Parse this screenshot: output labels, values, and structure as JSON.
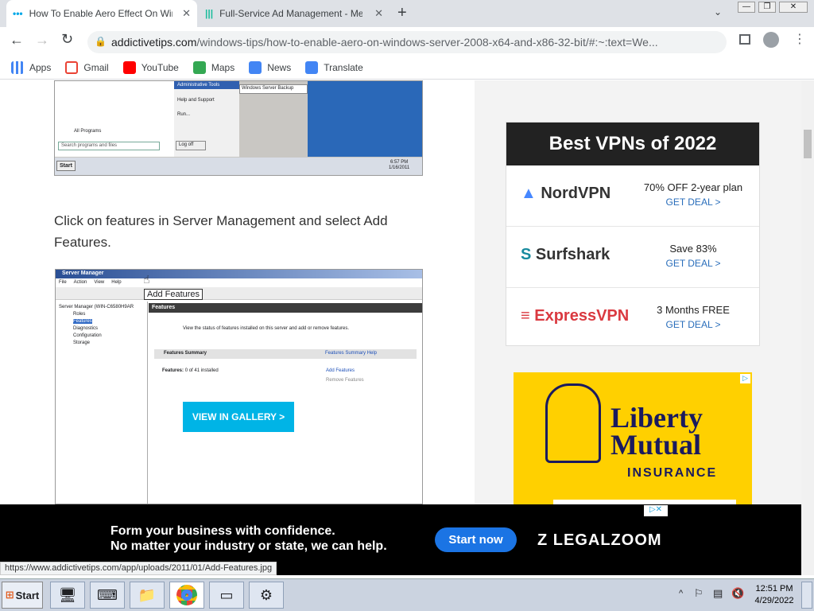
{
  "tabs": [
    {
      "title": "How To Enable Aero Effect On Wind",
      "active": true
    },
    {
      "title": "Full-Service Ad Management - Medi",
      "active": false
    }
  ],
  "window_controls": {
    "minimize": "—",
    "restore": "❐",
    "close": "✕"
  },
  "address": {
    "host": "addictivetips.com",
    "path": "/windows-tips/how-to-enable-aero-on-windows-server-2008-x64-and-x86-32-bit/#:~:text=We..."
  },
  "bookmarks": [
    {
      "label": "Apps",
      "color": "#4285f4"
    },
    {
      "label": "Gmail",
      "color": "#ea4335"
    },
    {
      "label": "YouTube",
      "color": "#ff0000"
    },
    {
      "label": "Maps",
      "color": "#34a853"
    },
    {
      "label": "News",
      "color": "#4285f4"
    },
    {
      "label": "Translate",
      "color": "#4285f4"
    }
  ],
  "article": {
    "shot1": {
      "admin_tools": "Administrative Tools",
      "wsb": "Windows Server Backup",
      "help": "Help and Support",
      "run": "Run...",
      "all_programs": "All Programs",
      "search": "Search programs and files",
      "logoff": "Log off",
      "clock_time": "6:57 PM",
      "clock_date": "1/16/2011",
      "start": "Start"
    },
    "paragraph": "Click on features in Server Management and select Add Features.",
    "shot2": {
      "title": "Server Manager",
      "menu": [
        "File",
        "Action",
        "View",
        "Help"
      ],
      "tooltip": "Add Features",
      "tree_root": "Server Manager (WIN-C6580H9AR",
      "tree_items": [
        "Roles",
        "Features",
        "Diagnostics",
        "Configuration",
        "Storage"
      ],
      "panel_title": "Features",
      "desc": "View the status of features installed on this server and add or remove features.",
      "summary": "Features Summary",
      "summary_help": "Features Summary Help",
      "features_label": "Features:",
      "features_count": "0 of 41 installed",
      "add_features": "Add Features",
      "remove_features": "Remove Features"
    },
    "gallery_button": "VIEW IN GALLERY >"
  },
  "vpn": {
    "heading": "Best VPNs of 2022",
    "items": [
      {
        "brand": "NordVPN",
        "deal": "70% OFF 2-year plan",
        "cta": "GET DEAL >",
        "color": "#4687ff"
      },
      {
        "brand": "Surfshark",
        "deal": "Save 83%",
        "cta": "GET DEAL >",
        "color": "#178a9e"
      },
      {
        "brand": "ExpressVPN",
        "deal": "3 Months FREE",
        "cta": "GET DEAL >",
        "color": "#da3940"
      }
    ]
  },
  "ad_liberty": {
    "line1": "Liberty",
    "line2": "Mutual",
    "insurance": "INSURANCE"
  },
  "banner": {
    "line1": "Form your business with confidence.",
    "line2": "No matter your industry or state, we can help.",
    "button": "Start now",
    "brand": "LEGALZOOM"
  },
  "status_url": "https://www.addictivetips.com/app/uploads/2011/01/Add-Features.jpg",
  "taskbar": {
    "start": "Start",
    "time": "12:51 PM",
    "date": "4/29/2022"
  }
}
